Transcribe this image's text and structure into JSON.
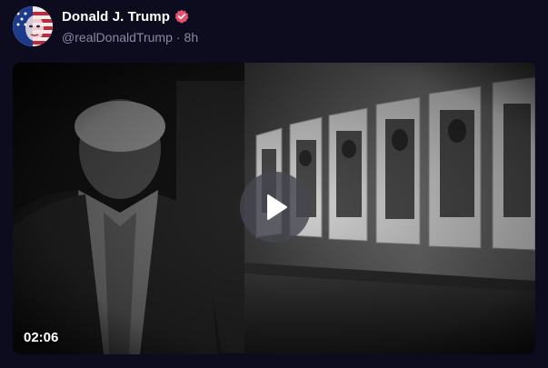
{
  "post": {
    "author_name": "Donald J. Trump",
    "handle": "@realDonaldTrump",
    "separator": "·",
    "time": "8h",
    "verified_icon": "verified-badge-icon",
    "verified_color": "#e8506e"
  },
  "media": {
    "type": "video",
    "duration": "02:06",
    "play_icon": "play-icon"
  },
  "colors": {
    "background": "#0d0b1e",
    "handle_text": "#8b88a6"
  }
}
